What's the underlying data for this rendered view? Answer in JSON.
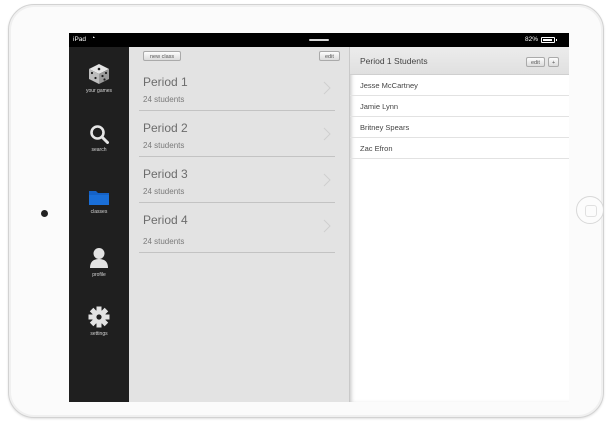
{
  "status_bar": {
    "carrier": "iPad",
    "battery": "82%"
  },
  "sidebar": {
    "items": [
      {
        "label": "your games",
        "icon": "dice-icon"
      },
      {
        "label": "search",
        "icon": "search-icon"
      },
      {
        "label": "classes",
        "icon": "folder-icon",
        "active": true
      },
      {
        "label": "profile",
        "icon": "person-icon"
      },
      {
        "label": "settings",
        "icon": "gear-icon"
      }
    ]
  },
  "class_list": {
    "new_class_label": "new class",
    "edit_label": "edit",
    "classes": [
      {
        "name": "Period 1",
        "count": "24 students"
      },
      {
        "name": "Period 2",
        "count": "24 students"
      },
      {
        "name": "Period 3",
        "count": "24 students"
      },
      {
        "name": "Period 4",
        "count": "24 students"
      }
    ]
  },
  "students_panel": {
    "title": "Period 1 Students",
    "edit_label": "edit",
    "add_label": "+",
    "students": [
      "Jesse McCartney",
      "Jamie Lynn",
      "Britney Spears",
      "Zac Efron"
    ]
  },
  "colors": {
    "sidebar_bg": "#1f1f1f",
    "folder_active": "#1a6fd8",
    "list_bg": "#e3e3e3"
  }
}
